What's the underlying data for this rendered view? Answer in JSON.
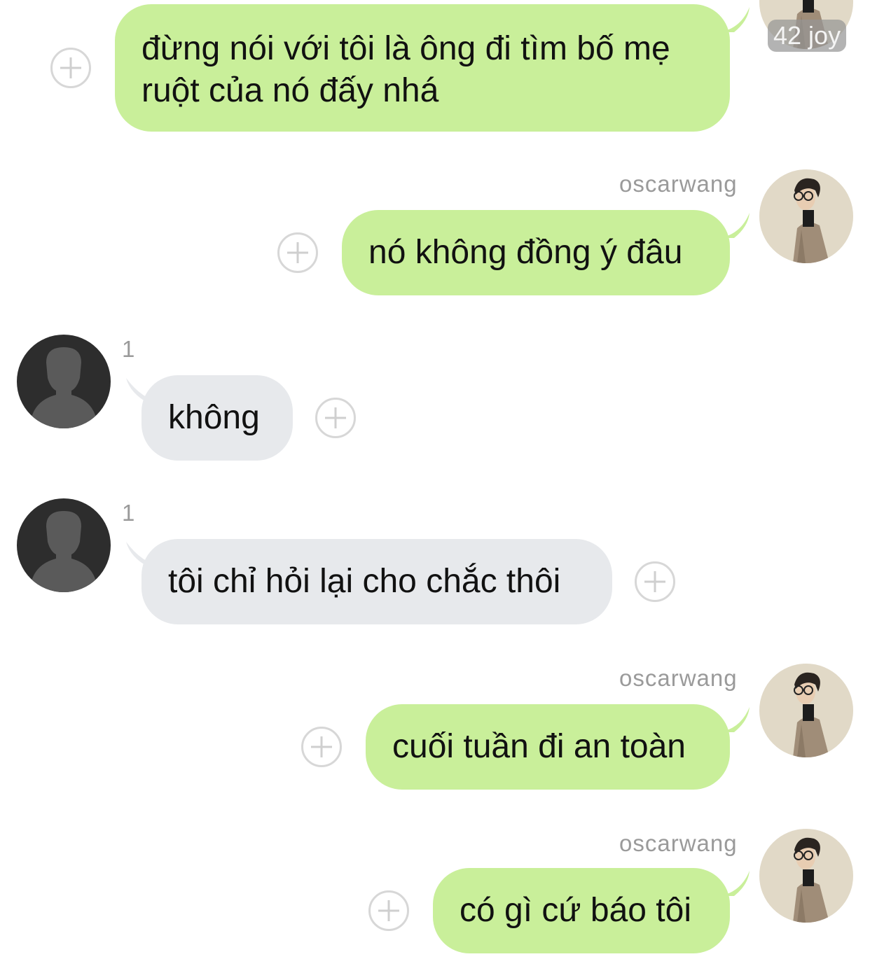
{
  "colors": {
    "outgoing_bubble": "#c9ef9a",
    "incoming_bubble": "#e7e9ec",
    "plus_icon": "#d7d7d7",
    "meta_text": "#9a9a9a"
  },
  "top_badge": "42 joy",
  "messages": [
    {
      "direction": "outgoing",
      "sender": "",
      "text": "đừng nói với tôi là ông đi tìm bố mẹ ruột của nó đấy nhá",
      "icon": "add-circle-icon"
    },
    {
      "direction": "outgoing",
      "sender": "oscarwang",
      "text": "nó không đồng ý đâu",
      "icon": "add-circle-icon"
    },
    {
      "direction": "incoming",
      "count": "1",
      "text": "không",
      "icon": "add-circle-icon"
    },
    {
      "direction": "incoming",
      "count": "1",
      "text": "tôi chỉ hỏi lại cho chắc thôi",
      "icon": "add-circle-icon"
    },
    {
      "direction": "outgoing",
      "sender": "oscarwang",
      "text": "cuối tuần đi an toàn",
      "icon": "add-circle-icon"
    },
    {
      "direction": "outgoing",
      "sender": "oscarwang",
      "text": "có gì cứ báo tôi",
      "icon": "add-circle-icon"
    }
  ]
}
